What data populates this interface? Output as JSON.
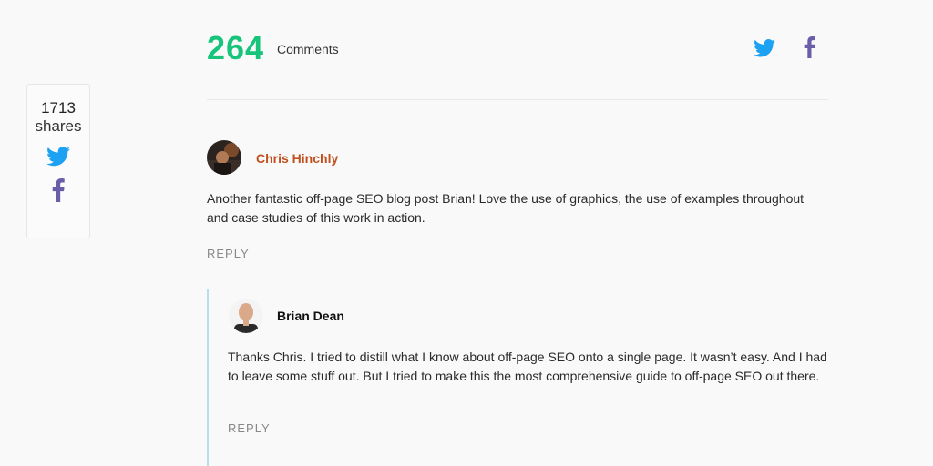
{
  "share": {
    "count": "1713",
    "label": "shares"
  },
  "header": {
    "comment_count": "264",
    "comment_word": "Comments"
  },
  "colors": {
    "accent_green": "#16c47a",
    "twitter_blue": "#1da1f2",
    "facebook_purple": "#6b5ea8",
    "commenter_name": "#c0511f"
  },
  "comments": [
    {
      "author": "Chris Hinchly",
      "text": "Another fantastic off-page SEO blog post Brian! Love the use of graphics, the use of examples throughout and case studies of this work in action.",
      "reply_label": "REPLY"
    },
    {
      "author": "Brian Dean",
      "text": "Thanks Chris. I tried to distill what I know about off-page SEO onto a single page. It wasn’t easy. And I had to leave some stuff out. But I tried to make this the most comprehensive guide to off-page SEO out there.",
      "reply_label": "REPLY"
    }
  ]
}
